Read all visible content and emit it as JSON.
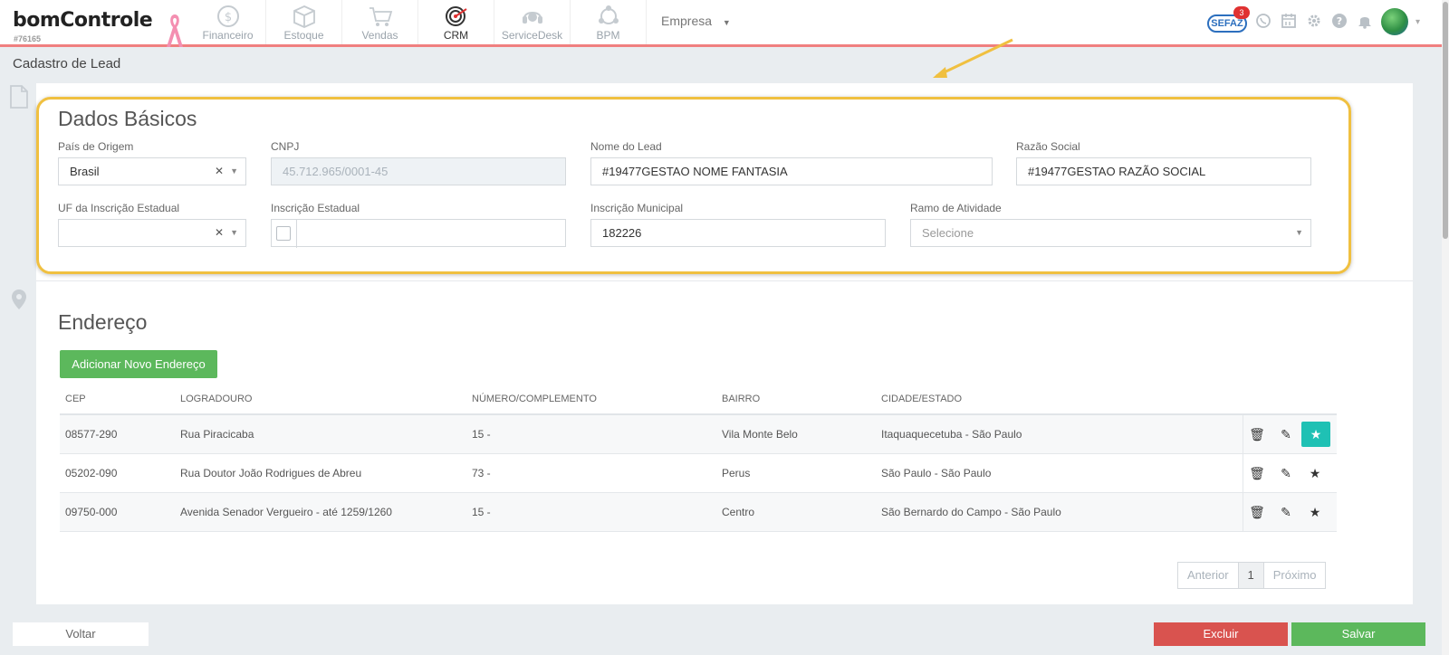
{
  "app": {
    "logo": "bomControle",
    "logo_id": "#76165",
    "modules": [
      {
        "label": "Financeiro",
        "icon": "dollar-coin-icon"
      },
      {
        "label": "Estoque",
        "icon": "box-icon"
      },
      {
        "label": "Vendas",
        "icon": "cart-icon"
      },
      {
        "label": "CRM",
        "icon": "target-icon"
      },
      {
        "label": "ServiceDesk",
        "icon": "headset-icon"
      },
      {
        "label": "BPM",
        "icon": "process-icon"
      }
    ],
    "active_module": "CRM",
    "company_menu": "Empresa",
    "sefaz_label": "SEFAZ",
    "sefaz_badge": "3"
  },
  "page": {
    "title": "Cadastro de Lead"
  },
  "basic": {
    "title": "Dados Básicos",
    "pais_label": "País de Origem",
    "pais_value": "Brasil",
    "cnpj_label": "CNPJ",
    "cnpj_value": "45.712.965/0001-45",
    "nome_label": "Nome do Lead",
    "nome_value": "#19477GESTAO NOME FANTASIA",
    "razao_label": "Razão Social",
    "razao_value": "#19477GESTAO RAZÃO SOCIAL",
    "uf_label": "UF da Inscrição Estadual",
    "uf_value": "",
    "ie_label": "Inscrição Estadual",
    "ie_value": "",
    "im_label": "Inscrição Municipal",
    "im_value": "182226",
    "ramo_label": "Ramo de Atividade",
    "ramo_placeholder": "Selecione"
  },
  "address": {
    "title": "Endereço",
    "add_button": "Adicionar Novo Endereço",
    "columns": [
      "CEP",
      "LOGRADOURO",
      "NÚMERO/COMPLEMENTO",
      "BAIRRO",
      "CIDADE/ESTADO"
    ],
    "rows": [
      {
        "cep": "08577-290",
        "logradouro": "Rua Piracicaba",
        "numero": "15 -",
        "bairro": "Vila Monte Belo",
        "cidade": "Itaquaquecetuba - São Paulo",
        "main": true
      },
      {
        "cep": "05202-090",
        "logradouro": "Rua Doutor João Rodrigues de Abreu",
        "numero": "73 -",
        "bairro": "Perus",
        "cidade": "São Paulo - São Paulo",
        "main": false
      },
      {
        "cep": "09750-000",
        "logradouro": "Avenida Senador Vergueiro - até 1259/1260",
        "numero": "15 -",
        "bairro": "Centro",
        "cidade": "São Bernardo do Campo - São Paulo",
        "main": false
      }
    ],
    "pager": {
      "prev": "Anterior",
      "current": "1",
      "next": "Próximo"
    }
  },
  "footer": {
    "back": "Voltar",
    "delete": "Excluir",
    "save": "Salvar"
  },
  "colors": {
    "accent_red": "#f07f7f",
    "green": "#5cb85c",
    "danger": "#d9534f",
    "teal": "#1fc1b4",
    "highlight": "#f0c040"
  }
}
